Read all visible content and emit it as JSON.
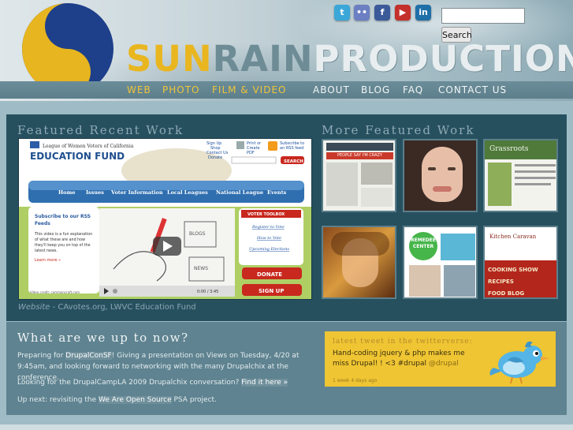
{
  "header": {
    "brand": {
      "sun": "SUN",
      "rain": "RAIN",
      "productions": "PRODUCTIONS"
    },
    "nav_left": [
      "WEB",
      "PHOTO",
      "FILM & VIDEO"
    ],
    "nav_right": [
      "ABOUT",
      "BLOG",
      "FAQ",
      "CONTACT US"
    ],
    "social": [
      {
        "icon": "twitter-icon",
        "glyph": "t",
        "color": "#3aa7d8"
      },
      {
        "icon": "flickr-icon",
        "glyph": "••",
        "color": "#6b7fc2"
      },
      {
        "icon": "facebook-icon",
        "glyph": "f",
        "color": "#3b5a9a"
      },
      {
        "icon": "youtube-icon",
        "glyph": "▶",
        "color": "#c4302b"
      },
      {
        "icon": "linkedin-icon",
        "glyph": "in",
        "color": "#1f6fa8"
      }
    ],
    "search": {
      "button_label": "Search",
      "value": ""
    }
  },
  "featured": {
    "title": "Featured Recent Work",
    "more_title": "More Featured Work",
    "caption_label": "Website",
    "caption_text": " - CAvotes.org, LWVC Education Fund",
    "site": {
      "org_line": "League of Women Voters of California",
      "name": "EDUCATION FUND",
      "top_links": [
        "Sign Up",
        "Shop",
        "Contact Us",
        "Donate"
      ],
      "print_links": [
        "Print or",
        "Create",
        "PDF"
      ],
      "rss_link": [
        "Subscribe to",
        "an RSS feed"
      ],
      "search_btn": "SEARCH",
      "tabs": [
        "Home",
        "Issues",
        "Voter Information",
        "Local Leagues",
        "National League",
        "Events"
      ],
      "rss_title": "Subscribe to our RSS Feeds",
      "rss_body": "This video is a fun explanation of what these are and how they'll keep you on top of the latest news.",
      "learn_more": "Learn more »",
      "video_credit": "Video credit: commoncraft.com",
      "video_time": "0:00 / 3:45",
      "toolbox_title": "VOTER TOOLBOX",
      "toolbox_links": [
        "Register to Vote",
        "How to Vote",
        "Upcoming Elections"
      ],
      "donate": "DONATE",
      "signup": "SIGN UP"
    },
    "thumbs": [
      {
        "name": "thumb-cinemax",
        "label": "PEOPLE SAY I'M CRAZY"
      },
      {
        "name": "thumb-portrait",
        "label": ""
      },
      {
        "name": "thumb-grassroots",
        "label": "Grassroots"
      },
      {
        "name": "thumb-painting",
        "label": ""
      },
      {
        "name": "thumb-remedee",
        "label": "REMEDEE CENTER"
      },
      {
        "name": "thumb-kitchen",
        "label": "Kitchen Caravan",
        "menu": [
          "COOKING SHOW",
          "RECIPES",
          "FOOD BLOG"
        ]
      }
    ]
  },
  "upto": {
    "title": "What are we up to now?",
    "p1_pre": "Preparing for ",
    "p1_link": "DrupalConSF",
    "p1_post": "! Giving a presentation on Views on Tuesday, 4/20 at 9:45am, and looking forward to networking with the many Drupalchix at the conference.",
    "p2_pre": "Looking for the DrupalCampLA 2009 Drupalchix conversation? ",
    "p2_link": "Find it here »",
    "p3_pre": "Up next: revisiting the ",
    "p3_link": "We Are Open Source",
    "p3_post": " PSA project."
  },
  "tweet": {
    "title": "latest tweet in the twitterverse:",
    "text": "Hand-coding jquery & php makes me miss Drupal! ! <3 #drupal ",
    "mention": "@drupal",
    "time": "1 week 4 days ago"
  },
  "colors": {
    "accent": "#f0c43a",
    "panel": "#27505f",
    "tweet_bg": "#efc533"
  }
}
